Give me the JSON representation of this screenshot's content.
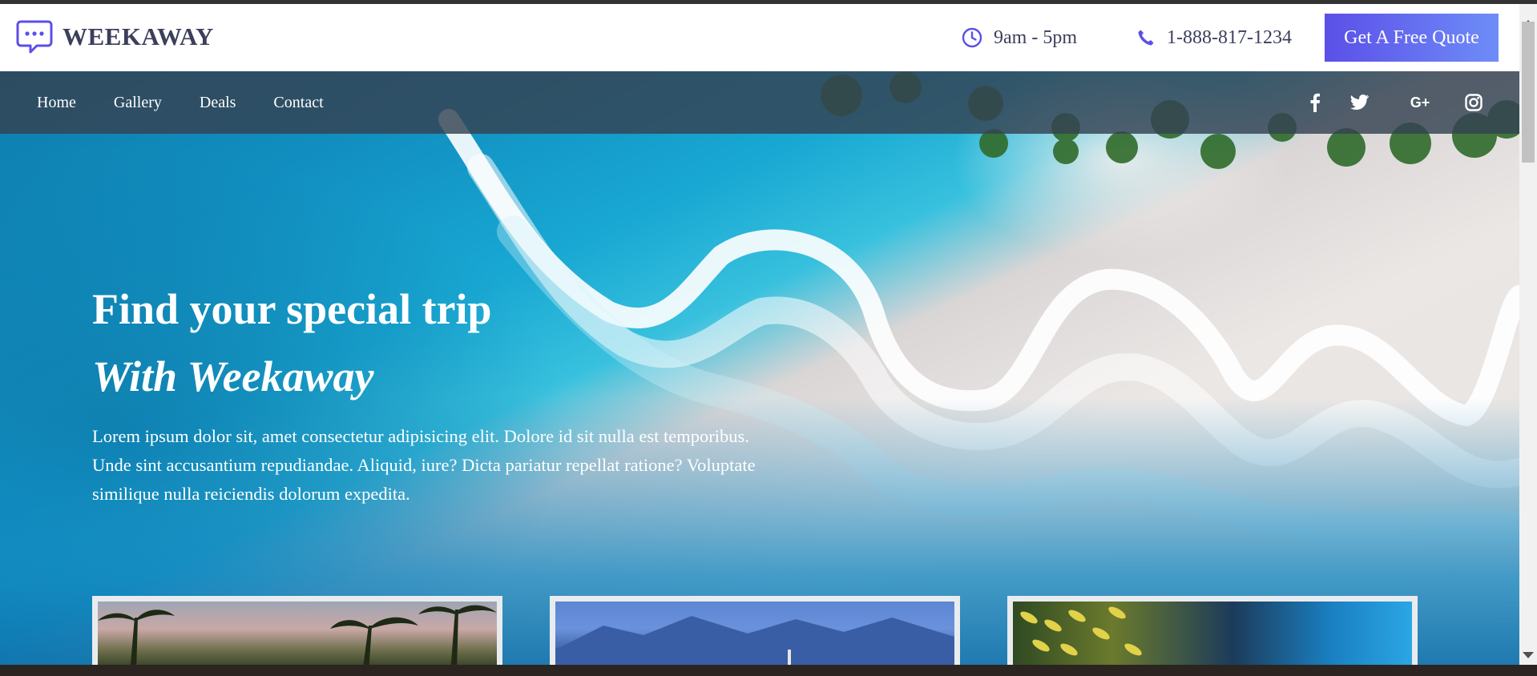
{
  "header": {
    "brand": "WEEKAWAY",
    "hours": "9am - 5pm",
    "phone": "1-888-817-1234",
    "quote_button": "Get A Free Quote",
    "accent_color": "#5b4fe8"
  },
  "nav": {
    "links": [
      "Home",
      "Gallery",
      "Deals",
      "Contact"
    ],
    "social_icons": [
      "facebook-icon",
      "twitter-icon",
      "google-plus-icon",
      "instagram-icon"
    ]
  },
  "hero": {
    "title": "Find your special trip",
    "subtitle": "With Weekaway",
    "text": "Lorem ipsum dolor sit, amet consectetur adipisicing elit. Dolore id sit nulla est temporibus. Unde sint accusantium repudiandae. Aliquid, iure? Dicta pariatur repellat ratione? Voluptate similique nulla reiciendis dolorum expedita."
  },
  "cards": [
    "palm-beach-image",
    "mountain-lake-image",
    "underwater-fish-image"
  ]
}
